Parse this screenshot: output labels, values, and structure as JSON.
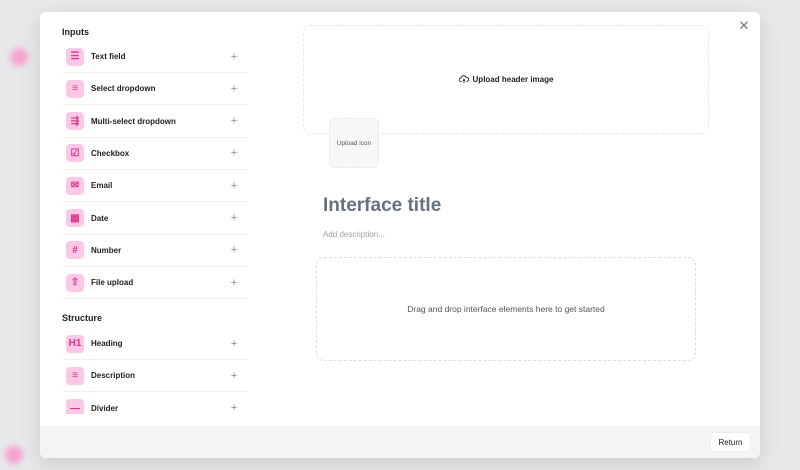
{
  "sidebar": {
    "inputs_heading": "Inputs",
    "inputs": [
      {
        "label": "Text field",
        "icon": "text-lines-icon"
      },
      {
        "label": "Select dropdown",
        "icon": "list-check-icon"
      },
      {
        "label": "Multi-select dropdown",
        "icon": "list-arrow-icon"
      },
      {
        "label": "Checkbox",
        "icon": "checkbox-icon"
      },
      {
        "label": "Email",
        "icon": "mail-icon"
      },
      {
        "label": "Date",
        "icon": "calendar-icon"
      },
      {
        "label": "Number",
        "icon": "hash-icon"
      },
      {
        "label": "File upload",
        "icon": "upload-icon"
      }
    ],
    "structure_heading": "Structure",
    "structure": [
      {
        "label": "Heading",
        "icon": "heading-icon"
      },
      {
        "label": "Description",
        "icon": "align-left-icon"
      },
      {
        "label": "Divider",
        "icon": "minus-icon"
      }
    ]
  },
  "canvas": {
    "upload_header": "Upload header image",
    "upload_icon": "Upload icon",
    "title": "Interface title",
    "description_placeholder": "Add description...",
    "dropzone": "Drag and drop interface elements here to get started"
  },
  "footer": {
    "return_label": "Return"
  },
  "colors": {
    "accent": "#e0358b",
    "accent_bg": "#fcc8e6"
  }
}
